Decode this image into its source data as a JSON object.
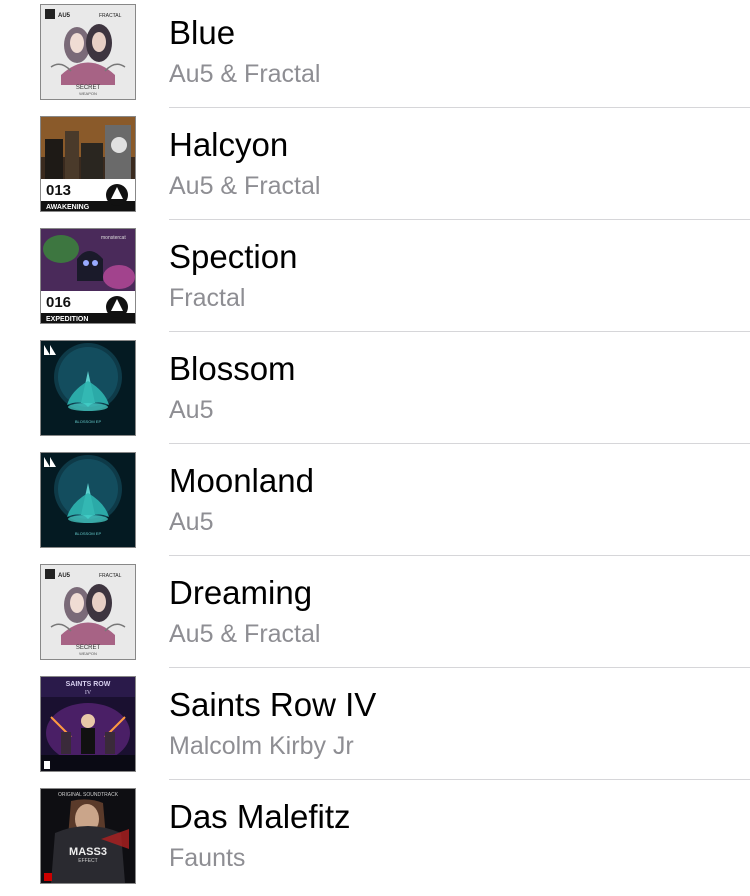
{
  "songs": [
    {
      "title": "Blue",
      "artist": "Au5 & Fractal",
      "art": "secret-weapon"
    },
    {
      "title": "Halcyon",
      "artist": "Au5 & Fractal",
      "art": "awakening"
    },
    {
      "title": "Spection",
      "artist": "Fractal",
      "art": "expedition"
    },
    {
      "title": "Blossom",
      "artist": "Au5",
      "art": "blossom"
    },
    {
      "title": "Moonland",
      "artist": "Au5",
      "art": "blossom"
    },
    {
      "title": "Dreaming",
      "artist": "Au5 & Fractal",
      "art": "secret-weapon"
    },
    {
      "title": "Saints Row IV",
      "artist": "Malcolm Kirby Jr",
      "art": "saints-row"
    },
    {
      "title": "Das Malefitz",
      "artist": "Faunts",
      "art": "mass-effect"
    }
  ],
  "art_text": {
    "secret_weapon": {
      "top_left": "AU5",
      "top_right": "FRACTAL",
      "line1": "SECRET",
      "line2": "WEAPON",
      "line3": "EP"
    },
    "awakening": {
      "number": "013",
      "label": "AWAKENING"
    },
    "expedition": {
      "number": "016",
      "label": "EXPEDITION",
      "brand": "monstercat"
    },
    "blossom": {
      "label": "BLOSSOM EP"
    },
    "saints_row": {
      "line1": "SAINTS ROW",
      "line2": "IV"
    },
    "mass_effect": {
      "top": "ORIGINAL SOUNDTRACK",
      "line1": "MASS3",
      "line2": "EFFECT"
    }
  }
}
